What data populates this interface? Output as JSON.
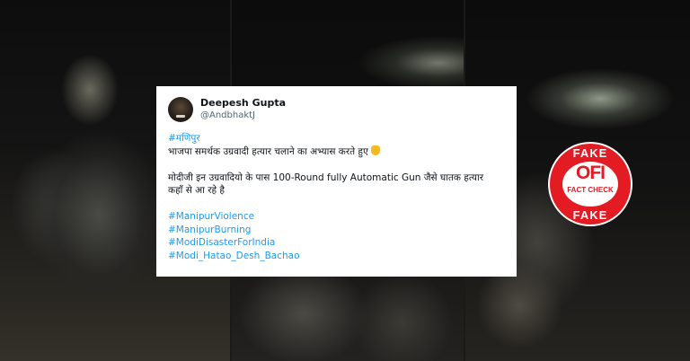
{
  "tweet": {
    "author_name": "Deepesh Gupta",
    "author_handle": "@AndbhaktJ",
    "lines": [
      "#मणिपुर",
      "भाजपा समर्थक उग्रवादी हत्यार चलाने का अभ्यास करते हुए",
      "मोदीजी इन उग्रवादियो के पास 100-Round fully Automatic Gun जैसे घातक हत्यार",
      "कहाँ से आ रहे है",
      "#ManipurViolence",
      "#ManipurBurning",
      "#ModiDisasterForIndia",
      "#Modi_Hatao_Desh_Bachao"
    ],
    "emoji_icon": "pointing-down-emoji",
    "avatar_icon": "user-avatar",
    "colors": {
      "hashtag": "#1d9bf0",
      "text": "#0f1419",
      "handle": "#536471"
    }
  },
  "badge": {
    "top": "FAKE",
    "logo": "OFI",
    "sub": "FACT CHECK",
    "bottom": "FAKE",
    "color": "#e31b23"
  }
}
